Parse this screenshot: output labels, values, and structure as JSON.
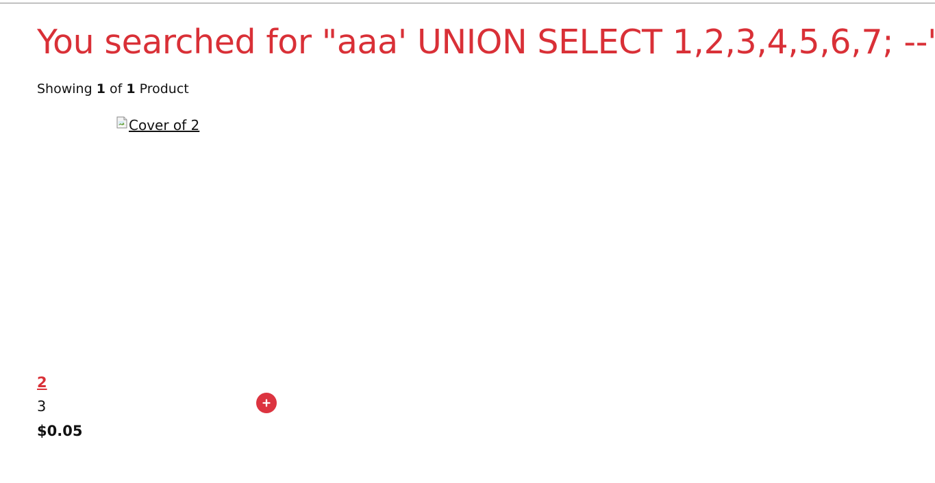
{
  "search": {
    "title": "You searched for \"aaa' UNION SELECT 1,2,3,4,5,6,7; --\"",
    "showing_prefix": "Showing ",
    "showing_count": "1",
    "showing_middle": " of ",
    "showing_total": "1",
    "showing_suffix": " Product"
  },
  "product": {
    "cover_alt": "Cover of 2",
    "name": "2",
    "subtitle": "3",
    "price": "$0.05",
    "add_icon": "plus-circle-icon"
  },
  "colors": {
    "accent": "#d93037",
    "button": "#dc3440",
    "text": "#111111"
  }
}
